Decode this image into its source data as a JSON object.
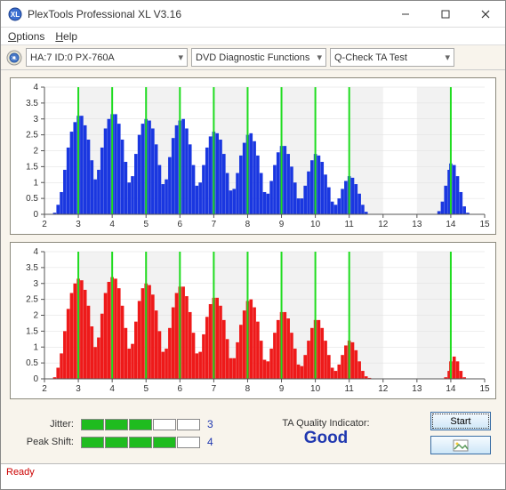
{
  "titlebar": {
    "title": "PlexTools Professional XL V3.16"
  },
  "menubar": {
    "options": "Options",
    "help": "Help"
  },
  "toolbar": {
    "device": "HA:7 ID:0   PX-760A",
    "function": "DVD Diagnostic Functions",
    "test": "Q-Check TA Test"
  },
  "meters": {
    "jitter": {
      "label": "Jitter:",
      "value": "3"
    },
    "peak": {
      "label": "Peak Shift:",
      "value": "4"
    }
  },
  "quality": {
    "label": "TA Quality Indicator:",
    "value": "Good"
  },
  "buttons": {
    "start": "Start"
  },
  "status": "Ready",
  "chart_data": [
    {
      "type": "bar",
      "color": "#1a37e0",
      "xlabel": "",
      "ylabel": "",
      "xlim": [
        2,
        15
      ],
      "ylim": [
        0,
        4
      ],
      "yticks": [
        0,
        0.5,
        1,
        1.5,
        2,
        2.5,
        3,
        3.5,
        4
      ],
      "xticks": [
        2,
        3,
        4,
        5,
        6,
        7,
        8,
        9,
        10,
        11,
        12,
        13,
        14,
        15
      ],
      "markers": [
        3,
        4,
        5,
        6,
        7,
        8,
        9,
        10,
        11,
        14
      ],
      "bars": [
        [
          2.3,
          0.05
        ],
        [
          2.4,
          0.3
        ],
        [
          2.5,
          0.7
        ],
        [
          2.6,
          1.4
        ],
        [
          2.7,
          2.1
        ],
        [
          2.8,
          2.6
        ],
        [
          2.9,
          2.9
        ],
        [
          3.0,
          3.1
        ],
        [
          3.1,
          3.1
        ],
        [
          3.2,
          2.8
        ],
        [
          3.3,
          2.35
        ],
        [
          3.4,
          1.7
        ],
        [
          3.5,
          1.1
        ],
        [
          3.6,
          1.4
        ],
        [
          3.7,
          2.1
        ],
        [
          3.8,
          2.7
        ],
        [
          3.9,
          3.0
        ],
        [
          4.0,
          3.15
        ],
        [
          4.1,
          3.15
        ],
        [
          4.2,
          2.85
        ],
        [
          4.3,
          2.35
        ],
        [
          4.4,
          1.65
        ],
        [
          4.5,
          1.0
        ],
        [
          4.6,
          1.2
        ],
        [
          4.7,
          1.9
        ],
        [
          4.8,
          2.5
        ],
        [
          4.9,
          2.85
        ],
        [
          5.0,
          3.0
        ],
        [
          5.1,
          2.95
        ],
        [
          5.2,
          2.7
        ],
        [
          5.3,
          2.2
        ],
        [
          5.4,
          1.55
        ],
        [
          5.5,
          0.95
        ],
        [
          5.6,
          1.1
        ],
        [
          5.7,
          1.8
        ],
        [
          5.8,
          2.4
        ],
        [
          5.9,
          2.8
        ],
        [
          6.0,
          2.95
        ],
        [
          6.1,
          3.0
        ],
        [
          6.2,
          2.7
        ],
        [
          6.3,
          2.2
        ],
        [
          6.4,
          1.55
        ],
        [
          6.5,
          0.9
        ],
        [
          6.6,
          1.0
        ],
        [
          6.7,
          1.55
        ],
        [
          6.8,
          2.1
        ],
        [
          6.9,
          2.45
        ],
        [
          7.0,
          2.6
        ],
        [
          7.1,
          2.55
        ],
        [
          7.2,
          2.35
        ],
        [
          7.3,
          1.9
        ],
        [
          7.4,
          1.3
        ],
        [
          7.5,
          0.75
        ],
        [
          7.6,
          0.8
        ],
        [
          7.7,
          1.3
        ],
        [
          7.8,
          1.85
        ],
        [
          7.9,
          2.25
        ],
        [
          8.0,
          2.5
        ],
        [
          8.1,
          2.55
        ],
        [
          8.2,
          2.3
        ],
        [
          8.3,
          1.85
        ],
        [
          8.4,
          1.3
        ],
        [
          8.5,
          0.7
        ],
        [
          8.6,
          0.65
        ],
        [
          8.7,
          1.05
        ],
        [
          8.8,
          1.55
        ],
        [
          8.9,
          1.95
        ],
        [
          9.0,
          2.15
        ],
        [
          9.1,
          2.15
        ],
        [
          9.2,
          1.9
        ],
        [
          9.3,
          1.5
        ],
        [
          9.4,
          1.0
        ],
        [
          9.5,
          0.5
        ],
        [
          9.6,
          0.5
        ],
        [
          9.7,
          0.9
        ],
        [
          9.8,
          1.35
        ],
        [
          9.9,
          1.7
        ],
        [
          10.0,
          1.9
        ],
        [
          10.1,
          1.85
        ],
        [
          10.2,
          1.65
        ],
        [
          10.3,
          1.25
        ],
        [
          10.4,
          0.85
        ],
        [
          10.5,
          0.4
        ],
        [
          10.6,
          0.3
        ],
        [
          10.7,
          0.5
        ],
        [
          10.8,
          0.8
        ],
        [
          10.9,
          1.05
        ],
        [
          11.0,
          1.2
        ],
        [
          11.1,
          1.15
        ],
        [
          11.2,
          0.95
        ],
        [
          11.3,
          0.65
        ],
        [
          11.4,
          0.3
        ],
        [
          11.5,
          0.08
        ],
        [
          13.65,
          0.1
        ],
        [
          13.75,
          0.4
        ],
        [
          13.85,
          0.9
        ],
        [
          13.95,
          1.4
        ],
        [
          14.0,
          1.6
        ],
        [
          14.1,
          1.55
        ],
        [
          14.2,
          1.2
        ],
        [
          14.3,
          0.7
        ],
        [
          14.4,
          0.25
        ],
        [
          14.5,
          0.05
        ]
      ]
    },
    {
      "type": "bar",
      "color": "#ee1a1a",
      "xlabel": "",
      "ylabel": "",
      "xlim": [
        2,
        15
      ],
      "ylim": [
        0,
        4
      ],
      "yticks": [
        0,
        0.5,
        1,
        1.5,
        2,
        2.5,
        3,
        3.5,
        4
      ],
      "xticks": [
        2,
        3,
        4,
        5,
        6,
        7,
        8,
        9,
        10,
        11,
        12,
        13,
        14,
        15
      ],
      "markers": [
        3,
        4,
        5,
        6,
        7,
        8,
        9,
        10,
        11,
        14
      ],
      "bars": [
        [
          2.3,
          0.05
        ],
        [
          2.4,
          0.35
        ],
        [
          2.5,
          0.8
        ],
        [
          2.6,
          1.5
        ],
        [
          2.7,
          2.2
        ],
        [
          2.8,
          2.7
        ],
        [
          2.9,
          3.0
        ],
        [
          3.0,
          3.15
        ],
        [
          3.1,
          3.1
        ],
        [
          3.2,
          2.8
        ],
        [
          3.3,
          2.3
        ],
        [
          3.4,
          1.65
        ],
        [
          3.5,
          1.0
        ],
        [
          3.6,
          1.3
        ],
        [
          3.7,
          2.05
        ],
        [
          3.8,
          2.7
        ],
        [
          3.9,
          3.05
        ],
        [
          4.0,
          3.2
        ],
        [
          4.1,
          3.15
        ],
        [
          4.2,
          2.85
        ],
        [
          4.3,
          2.3
        ],
        [
          4.4,
          1.6
        ],
        [
          4.5,
          0.95
        ],
        [
          4.6,
          1.1
        ],
        [
          4.7,
          1.8
        ],
        [
          4.8,
          2.45
        ],
        [
          4.9,
          2.85
        ],
        [
          5.0,
          3.0
        ],
        [
          5.1,
          2.95
        ],
        [
          5.2,
          2.65
        ],
        [
          5.3,
          2.15
        ],
        [
          5.4,
          1.5
        ],
        [
          5.5,
          0.85
        ],
        [
          5.6,
          0.95
        ],
        [
          5.7,
          1.6
        ],
        [
          5.8,
          2.25
        ],
        [
          5.9,
          2.7
        ],
        [
          6.0,
          2.9
        ],
        [
          6.1,
          2.9
        ],
        [
          6.2,
          2.6
        ],
        [
          6.3,
          2.1
        ],
        [
          6.4,
          1.45
        ],
        [
          6.5,
          0.8
        ],
        [
          6.6,
          0.85
        ],
        [
          6.7,
          1.4
        ],
        [
          6.8,
          1.95
        ],
        [
          6.9,
          2.35
        ],
        [
          7.0,
          2.55
        ],
        [
          7.1,
          2.55
        ],
        [
          7.2,
          2.3
        ],
        [
          7.3,
          1.85
        ],
        [
          7.4,
          1.25
        ],
        [
          7.5,
          0.65
        ],
        [
          7.6,
          0.65
        ],
        [
          7.7,
          1.15
        ],
        [
          7.8,
          1.7
        ],
        [
          7.9,
          2.15
        ],
        [
          8.0,
          2.45
        ],
        [
          8.1,
          2.5
        ],
        [
          8.2,
          2.25
        ],
        [
          8.3,
          1.8
        ],
        [
          8.4,
          1.2
        ],
        [
          8.5,
          0.6
        ],
        [
          8.6,
          0.55
        ],
        [
          8.7,
          0.95
        ],
        [
          8.8,
          1.45
        ],
        [
          8.9,
          1.85
        ],
        [
          9.0,
          2.1
        ],
        [
          9.1,
          2.1
        ],
        [
          9.2,
          1.9
        ],
        [
          9.3,
          1.45
        ],
        [
          9.4,
          0.95
        ],
        [
          9.5,
          0.45
        ],
        [
          9.6,
          0.4
        ],
        [
          9.7,
          0.75
        ],
        [
          9.8,
          1.2
        ],
        [
          9.9,
          1.6
        ],
        [
          10.0,
          1.85
        ],
        [
          10.1,
          1.85
        ],
        [
          10.2,
          1.6
        ],
        [
          10.3,
          1.2
        ],
        [
          10.4,
          0.75
        ],
        [
          10.5,
          0.35
        ],
        [
          10.6,
          0.25
        ],
        [
          10.7,
          0.45
        ],
        [
          10.8,
          0.75
        ],
        [
          10.9,
          1.05
        ],
        [
          11.0,
          1.2
        ],
        [
          11.1,
          1.15
        ],
        [
          11.2,
          0.9
        ],
        [
          11.3,
          0.55
        ],
        [
          11.4,
          0.25
        ],
        [
          11.5,
          0.08
        ],
        [
          11.6,
          0.03
        ],
        [
          13.85,
          0.05
        ],
        [
          13.95,
          0.25
        ],
        [
          14.0,
          0.55
        ],
        [
          14.1,
          0.7
        ],
        [
          14.2,
          0.55
        ],
        [
          14.3,
          0.25
        ],
        [
          14.4,
          0.05
        ]
      ]
    }
  ]
}
